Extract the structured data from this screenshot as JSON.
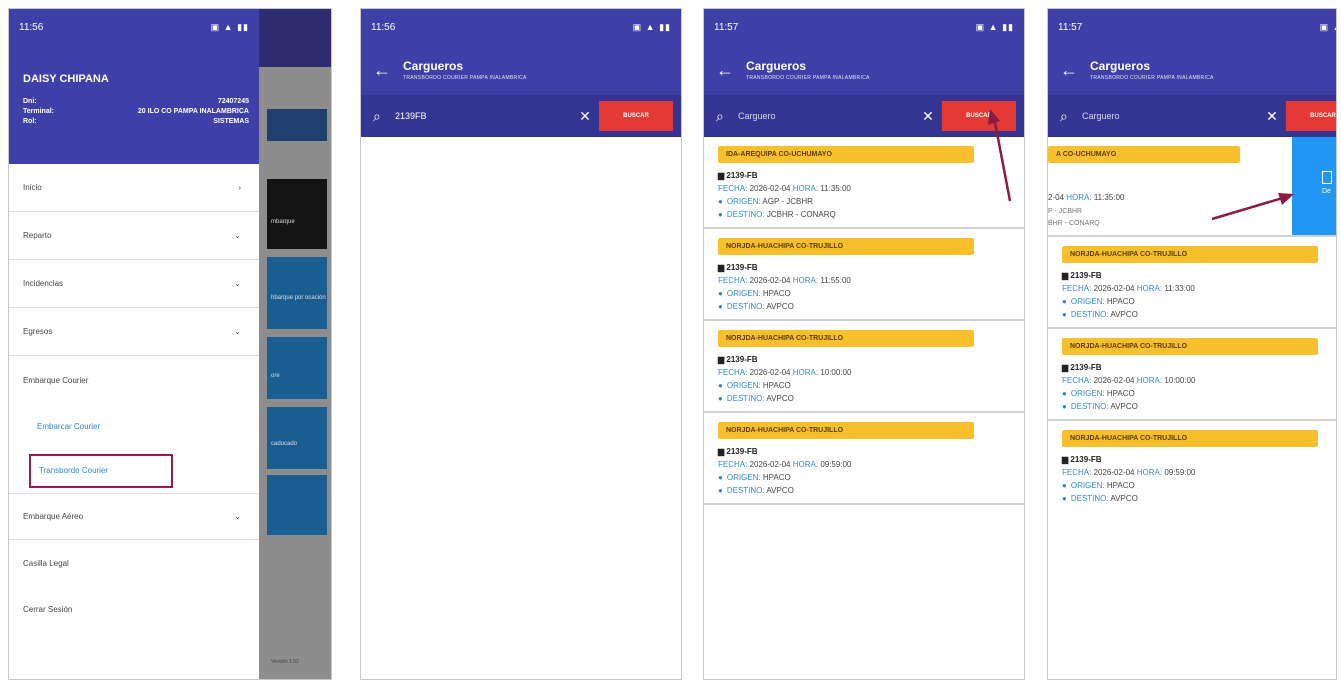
{
  "screens": {
    "drawer": {
      "status_time": "11:56",
      "user_name": "DAISY CHIPANA",
      "dni_label": "Dni:",
      "dni_value": "72407245",
      "terminal_label": "Terminal:",
      "terminal_value": "20 ILO CO PAMPA INALAMBRICA",
      "rol_label": "Rol:",
      "rol_value": "SISTEMAS",
      "menu": [
        {
          "label": "Inicio",
          "icon": "chevron-right-icon"
        },
        {
          "label": "Reparto",
          "icon": "chevron-down-icon"
        },
        {
          "label": "Incidencias",
          "icon": "chevron-down-icon"
        },
        {
          "label": "Egresos",
          "icon": "chevron-down-icon"
        },
        {
          "label": "Embarque Courier",
          "icon": ""
        },
        {
          "label": "Embarcar Courier",
          "icon": ""
        },
        {
          "label": "Transbordo Courier",
          "icon": ""
        },
        {
          "label": "Embarque Aéreo",
          "icon": "chevron-down-icon"
        },
        {
          "label": "Casilla Legal",
          "icon": ""
        },
        {
          "label": "Cerrar Sesión",
          "icon": ""
        }
      ],
      "bg_tile_labels": [
        "mbarque",
        "hbarque por ocación",
        "ore",
        "caducado"
      ],
      "footer_text": "Versión 1.52"
    },
    "search": {
      "status_time": "11:56",
      "title": "Cargueros",
      "subtitle": "TRANSBORDO COURIER PAMPA INALAMBRICA",
      "query": "2139FB",
      "button": "BUSCAR"
    },
    "results": {
      "status_time": "11:57",
      "title": "Cargueros",
      "subtitle": "TRANSBORDO COURIER PAMPA INALAMBRICA",
      "query_placeholder": "Carguero",
      "button": "BUSCAR",
      "cards": [
        {
          "route": "IDA-AREQUIPA CO-UCHUMAYO",
          "plate": "2139-FB",
          "fecha": "2026-02-04",
          "hora": "11:35:00",
          "origen": "AGP - JCBHR",
          "destino": "JCBHR - CONARQ"
        },
        {
          "route": "NORJDA-HUACHIPA CO-TRUJILLO",
          "plate": "2139-FB",
          "fecha": "2026-02-04",
          "hora": "11:55:00",
          "origen": "HPACO",
          "destino": "AVPCO"
        },
        {
          "route": "NORJDA-HUACHIPA CO-TRUJILLO",
          "plate": "2139-FB",
          "fecha": "2026-02-04",
          "hora": "10:00:00",
          "origen": "HPACO",
          "destino": "AVPCO"
        },
        {
          "route": "NORJDA-HUACHIPA CO-TRUJILLO",
          "plate": "2139-FB",
          "fecha": "2026-02-04",
          "hora": "09:59:00",
          "origen": "HPACO",
          "destino": "AVPCO"
        }
      ]
    },
    "swiped": {
      "status_time": "11:57",
      "title": "Cargueros",
      "subtitle": "TRANSBORDO COURIER PAMPA INALAMBRICA",
      "query_placeholder": "Carguero",
      "button": "BUSCAR",
      "first_route": "A CO-UCHUMAYO",
      "first_line1": "2-04",
      "first_hora_label": "HORA:",
      "first_hora": "11:35:00",
      "first_line2": "P - JCBHR",
      "first_line3": "BHR - CONARQ",
      "action_label": "De",
      "cards": [
        {
          "route": "NORJDA-HUACHIPA CO-TRUJILLO",
          "plate": "2139-FB",
          "fecha": "2026-02-04",
          "hora": "11:33:00",
          "origen": "HPACO",
          "destino": "AVPCO"
        },
        {
          "route": "NORJDA-HUACHIPA CO-TRUJILLO",
          "plate": "2139-FB",
          "fecha": "2026-02-04",
          "hora": "10:00:00",
          "origen": "HPACO",
          "destino": "AVPCO"
        },
        {
          "route": "NORJDA-HUACHIPA CO-TRUJILLO",
          "plate": "2139-FB",
          "fecha": "2026-02-04",
          "hora": "09:59:00",
          "origen": "HPACO",
          "destino": "AVPCO"
        }
      ]
    }
  },
  "labels": {
    "fecha": "FECHA:",
    "hora": "HORA:",
    "origen": "ORIGEN:",
    "destino": "DESTINO:"
  },
  "colors": {
    "primary": "#3f3fa8",
    "primary_dark": "#343492",
    "accent_red": "#e53935",
    "route_yellow": "#f9c02d",
    "link_blue": "#2e88d8",
    "highlight_border": "#9c1a4e",
    "swipe_action": "#2196f3"
  }
}
